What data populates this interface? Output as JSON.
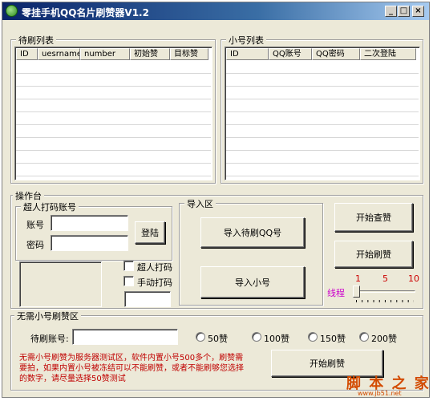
{
  "window": {
    "title": "零挂手机QQ名片刷赞器V1.2",
    "minimize": "_",
    "maximize": "□",
    "close": "×"
  },
  "pending_list": {
    "legend": "待刷列表",
    "columns": [
      "ID",
      "uesrname",
      "number",
      "初始赞",
      "目标赞"
    ]
  },
  "account_list": {
    "legend": "小号列表",
    "columns": [
      "ID",
      "QQ账号",
      "QQ密码",
      "二次登陆"
    ]
  },
  "console": {
    "legend": "操作台",
    "captcha": {
      "legend": "超人打码账号",
      "account_label": "账号",
      "password_label": "密码",
      "login_button": "登陆"
    },
    "super_captcha_label": "超人打码",
    "manual_captcha_label": "手动打码",
    "import": {
      "legend": "导入区",
      "import_pending_button": "导入待刷QQ号",
      "import_accounts_button": "导入小号"
    },
    "start_check_button": "开始查赞",
    "start_like_button": "开始刷赞",
    "threads": {
      "label": "线程",
      "ticks": [
        "1",
        "5",
        "10"
      ],
      "value": 1,
      "min": 1,
      "max": 10
    }
  },
  "no_account": {
    "legend": "无需小号刷赞区",
    "target_label": "待刷账号:",
    "options": [
      "50赞",
      "100赞",
      "150赞",
      "200赞"
    ],
    "note": "无需小号刷赞为服务器测试区，软件内置小号500多个，刷赞需要拍，如果内置小号被冻结可以不能刷赞，或者不能刷够您选择的数字，请尽量选择50赞测试",
    "start_button": "开始刷赞"
  },
  "watermark": {
    "brand": "脚 本 之 家",
    "url": "www.jb51.net"
  },
  "colors": {
    "note_red": "#c00000",
    "thread_label": "#cc00cc",
    "tick_red": "#cc0000"
  }
}
